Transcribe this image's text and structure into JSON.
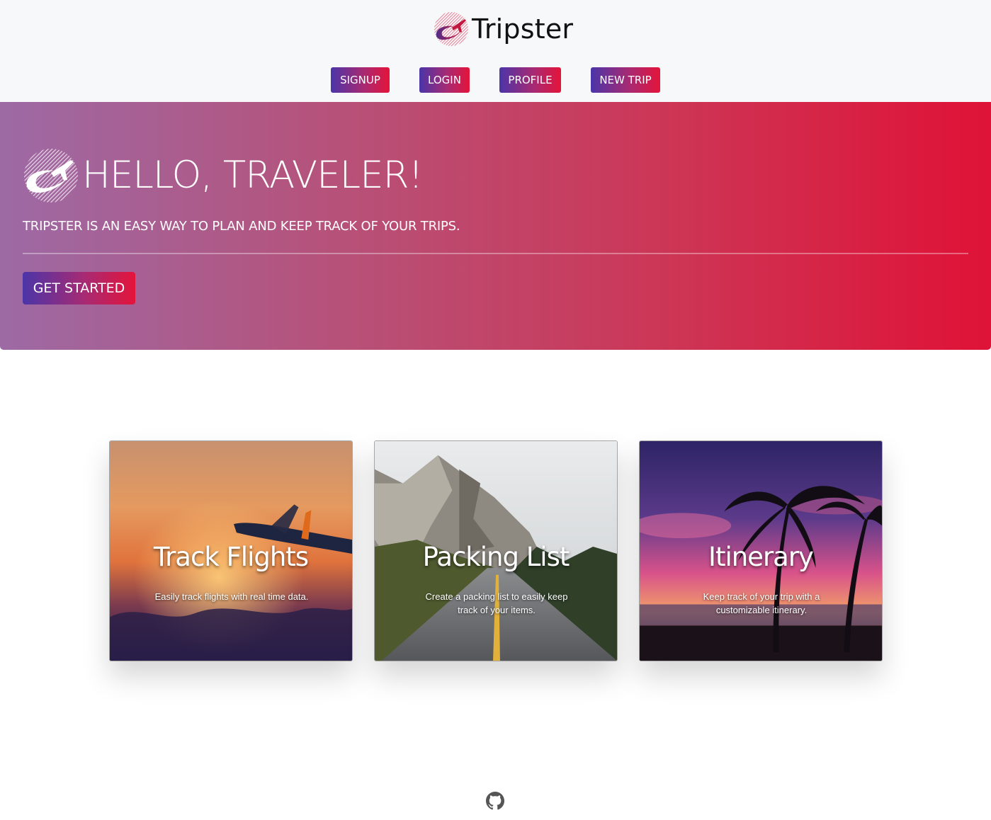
{
  "brand": {
    "name": "Tripster"
  },
  "nav": [
    {
      "label": "SIGNUP"
    },
    {
      "label": "LOGIN"
    },
    {
      "label": "PROFILE"
    },
    {
      "label": "NEW TRIP"
    }
  ],
  "hero": {
    "title": "HELLO, TRAVELER!",
    "subtitle": "TRIPSTER IS AN EASY WAY TO PLAN AND KEEP TRACK OF YOUR TRIPS.",
    "cta": "GET STARTED"
  },
  "cards": [
    {
      "title": "Track Flights",
      "text": "Easily track flights with real time data."
    },
    {
      "title": "Packing List",
      "text": "Create a packing list to easily keep track of your items."
    },
    {
      "title": "Itinerary",
      "text": "Keep track of your trip with a customizable itinerary."
    }
  ],
  "footer": {
    "icon": "github-icon"
  },
  "colors": {
    "gradient_start": "#4b35a8",
    "gradient_end": "#e4143a",
    "hero_start": "#9d6aa5",
    "hero_end": "#df1237"
  }
}
